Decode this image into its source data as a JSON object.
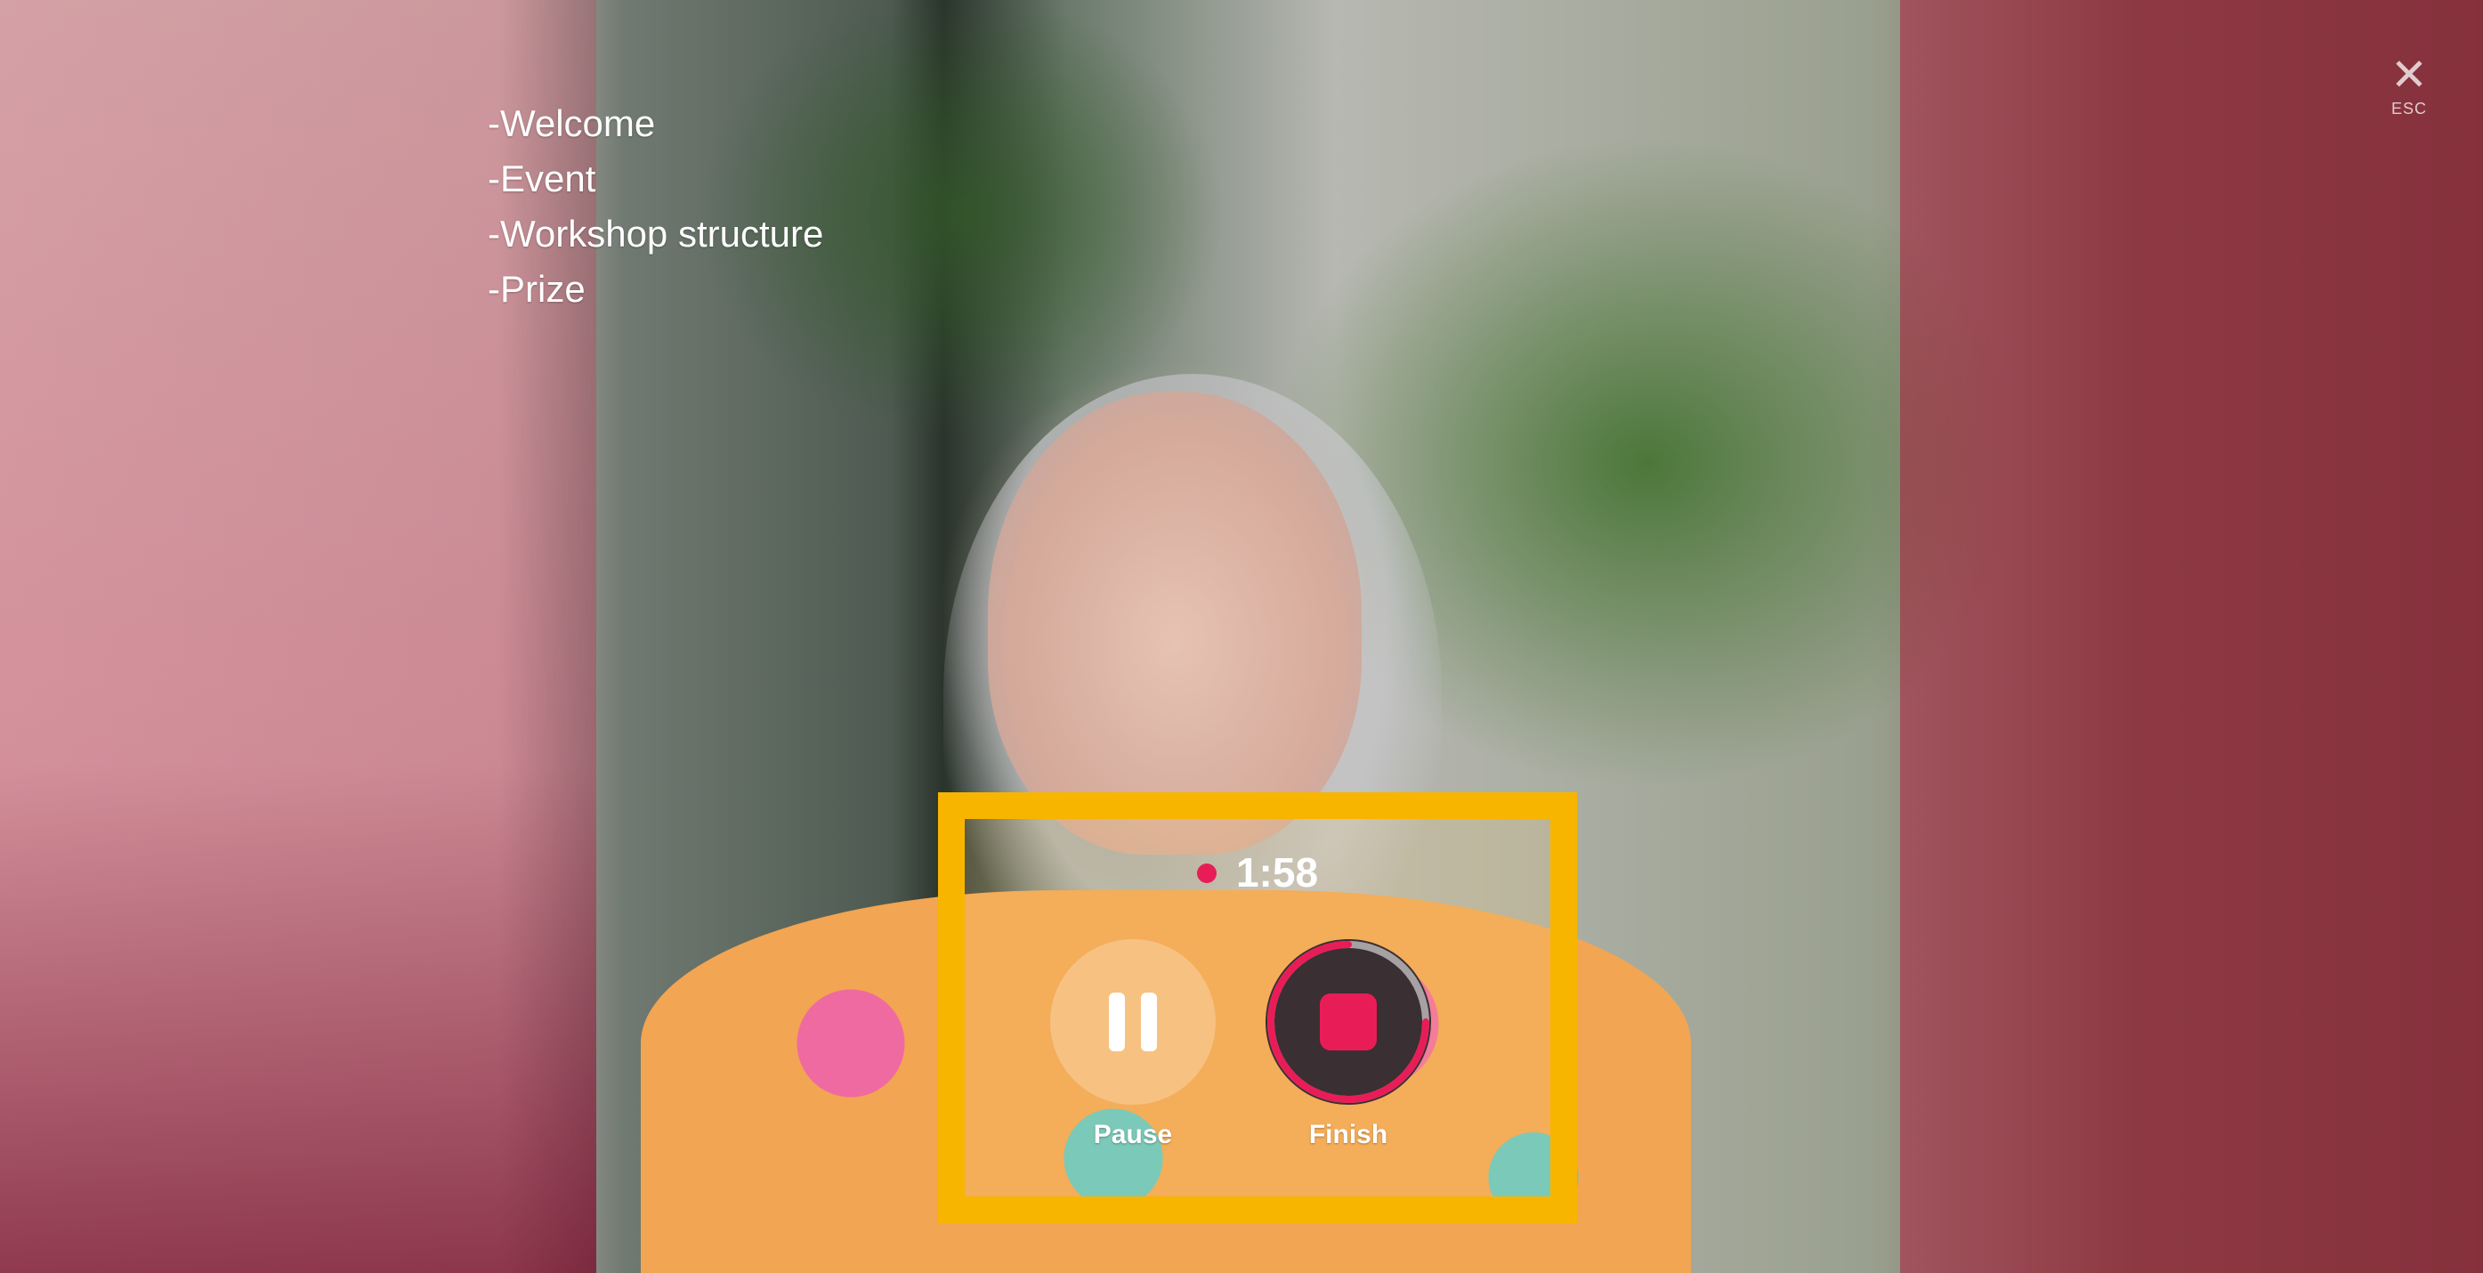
{
  "agenda": {
    "items": [
      "-Welcome",
      "-Event",
      "-Workshop structure",
      "-Prize"
    ]
  },
  "close": {
    "icon": "close-icon",
    "glyph": "✕",
    "shortcut_label": "ESC"
  },
  "recorder": {
    "timer": "1:58",
    "pause_label": "Pause",
    "finish_label": "Finish",
    "finish_progress": 0.25,
    "colors": {
      "highlight_border": "#f8b500",
      "record_accent": "#e81d57"
    }
  }
}
